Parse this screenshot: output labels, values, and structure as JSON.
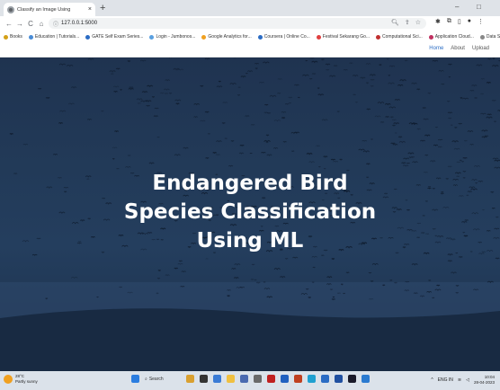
{
  "browser": {
    "tab_title": "Classify an Image Using",
    "new_tab": "+",
    "url": "127.0.0.1:5000",
    "window_controls": [
      "–",
      "□"
    ],
    "nav": {
      "back": "←",
      "forward": "→",
      "reload": "C",
      "home": "⌂"
    }
  },
  "bookmarks": [
    {
      "label": "Books",
      "color": "#d4a017"
    },
    {
      "label": "Education | Tutorials...",
      "color": "#4a8cd6"
    },
    {
      "label": "GATE Self Exam Series...",
      "color": "#2b6cc4"
    },
    {
      "label": "Login - Jumbonos...",
      "color": "#5aa0e0"
    },
    {
      "label": "Google Analytics for...",
      "color": "#f0a020"
    },
    {
      "label": "Coursera | Online Co...",
      "color": "#2b6cc4"
    },
    {
      "label": "Festival Sekarang Go...",
      "color": "#e04040"
    },
    {
      "label": "Computational Sci...",
      "color": "#c03030"
    },
    {
      "label": "Application Cloud...",
      "color": "#c03060"
    },
    {
      "label": "Data Science: MCD...",
      "color": "#888888"
    }
  ],
  "site_nav": {
    "home": "Home",
    "about": "About",
    "upload": "Upload"
  },
  "hero": {
    "title_line1": "Endangered Bird",
    "title_line2": "Species Classification",
    "title_line3": "Using ML"
  },
  "taskbar": {
    "weather_temp": "28°C",
    "weather_desc": "Partly sunny",
    "search_label": "Search",
    "lang": "ENG IN",
    "time": "10:04",
    "date": "28-04-2023"
  }
}
